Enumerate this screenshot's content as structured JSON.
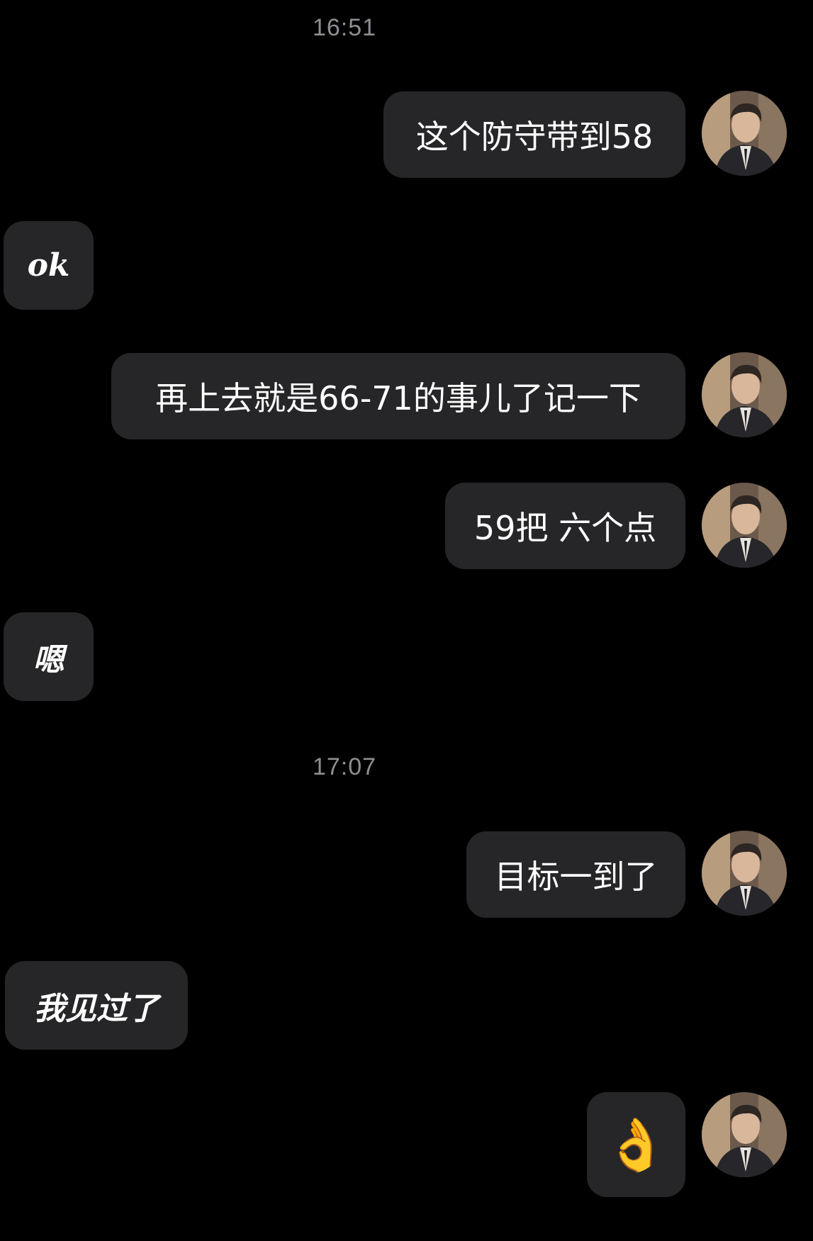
{
  "timestamps": [
    "16:51",
    "17:07"
  ],
  "messages": [
    {
      "side": "out",
      "text": "这个防守带到58"
    },
    {
      "side": "in",
      "text": "ok"
    },
    {
      "side": "out",
      "text": "再上去就是66-71的事儿了记一下"
    },
    {
      "side": "out",
      "text": "59把 六个点"
    },
    {
      "side": "in",
      "text": "嗯"
    },
    {
      "side": "out",
      "text": "目标一到了"
    },
    {
      "side": "in",
      "text": "我见过了"
    },
    {
      "side": "out",
      "text": "👌"
    }
  ],
  "colors": {
    "background": "#000000",
    "bubble": "#262628",
    "timestamp": "#8e8e93",
    "text": "#ffffff"
  },
  "icons": {
    "avatar": "man-in-suit-avatar-icon",
    "ok_hand": "ok-hand-emoji"
  }
}
